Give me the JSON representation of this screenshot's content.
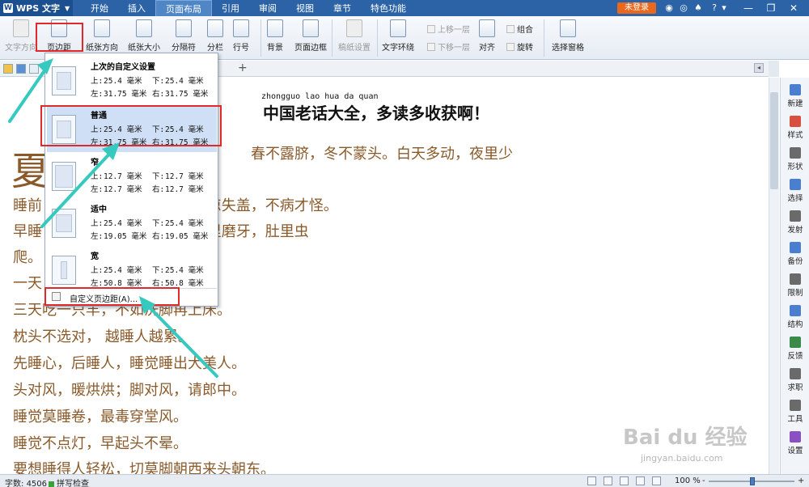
{
  "titlebar": {
    "app_name": "WPS 文字",
    "tabs": [
      "开始",
      "插入",
      "页面布局",
      "引用",
      "审阅",
      "视图",
      "章节",
      "特色功能"
    ],
    "active_tab": "页面布局",
    "login_badge": "未登录",
    "help": "?"
  },
  "ribbon": {
    "text_direction": "文字方向",
    "margins": "页边距",
    "orientation": "纸张方向",
    "paper_size": "纸张大小",
    "separator": "分隔符",
    "columns": "分栏",
    "line_numbers": "行号",
    "background": "背景",
    "page_border": "页面边框",
    "manuscript": "稿纸设置",
    "text_wrap": "文字环绕",
    "bring_forward": "上移一层",
    "send_backward": "下移一层",
    "align": "对齐",
    "group": "组合",
    "rotate": "旋转",
    "selection_pane": "选择窗格"
  },
  "tabbar": {
    "add": "+"
  },
  "margin_menu": {
    "presets": [
      {
        "name": "上次的自定义设置",
        "top_label": "上:",
        "top": "25.4 毫米",
        "bottom_label": "下:",
        "bottom": "25.4 毫米",
        "left_label": "左:",
        "left": "31.75 毫米",
        "right_label": "右:",
        "right": "31.75 毫米"
      },
      {
        "name": "普通",
        "top_label": "上:",
        "top": "25.4 毫米",
        "bottom_label": "下:",
        "bottom": "25.4 毫米",
        "left_label": "左:",
        "left": "31.75 毫米",
        "right_label": "右:",
        "right": "31.75 毫米"
      },
      {
        "name": "窄",
        "top_label": "上:",
        "top": "12.7 毫米",
        "bottom_label": "下:",
        "bottom": "12.7 毫米",
        "left_label": "左:",
        "left": "12.7 毫米",
        "right_label": "右:",
        "right": "12.7 毫米"
      },
      {
        "name": "适中",
        "top_label": "上:",
        "top": "25.4 毫米",
        "bottom_label": "下:",
        "bottom": "25.4 毫米",
        "left_label": "左:",
        "left": "19.05 毫米",
        "right_label": "右:",
        "right": "19.05 毫米"
      },
      {
        "name": "宽",
        "top_label": "上:",
        "top": "25.4 毫米",
        "bottom_label": "下:",
        "bottom": "25.4 毫米",
        "left_label": "左:",
        "left": "50.8 毫米",
        "right_label": "右:",
        "right": "50.8 毫米"
      }
    ],
    "custom": "自定义页边距(A)..."
  },
  "document": {
    "pinyin": "zhongguo lao hua da quan",
    "title": "中国老话大全，多读多收获啊！",
    "dropcap": "夏",
    "lines": [
      "春不露脐，冬不蒙头。白天多动，夜里少",
      "睡前                      晚上开窗，一觉都香。贪凉失盖，不病才怪。",
      "早睡                      贪房贪睡，添病减岁。夜里磨牙，肚里虫",
      "爬。",
      "一天                      打呼噜。",
      "三天吃一只羊，不如洗脚再上床。",
      "枕头不选对，  越睡人越累。",
      "先睡心，后睡人，睡觉睡出大美人。",
      "头对风，暖烘烘；脚对风，请郎中。",
      "睡觉莫睡卷，最毒穿堂风。",
      "睡觉不点灯，早起头不晕。",
      "要想睡得人轻松，切莫脚朝西来头朝东。"
    ]
  },
  "sidebar": {
    "items": [
      "新建",
      "样式",
      "形状",
      "选择",
      "发射",
      "备份",
      "限制",
      "结构",
      "反馈",
      "求职",
      "工具",
      "设置"
    ]
  },
  "statusbar": {
    "word_count_label": "字数:",
    "word_count": "4506",
    "spellcheck": "拼写检查",
    "zoom": "100 %",
    "zoom_minus": "-",
    "zoom_plus": "+"
  },
  "watermark": {
    "main": "Bai du 经验",
    "sub": "jingyan.baidu.com"
  },
  "colors": {
    "title_bar": "#2b63a6",
    "highlight_red": "#e0292b",
    "arrow_teal": "#36c9c0",
    "doc_text": "#8b5a2b",
    "selected_preset": "#cfdff5"
  }
}
